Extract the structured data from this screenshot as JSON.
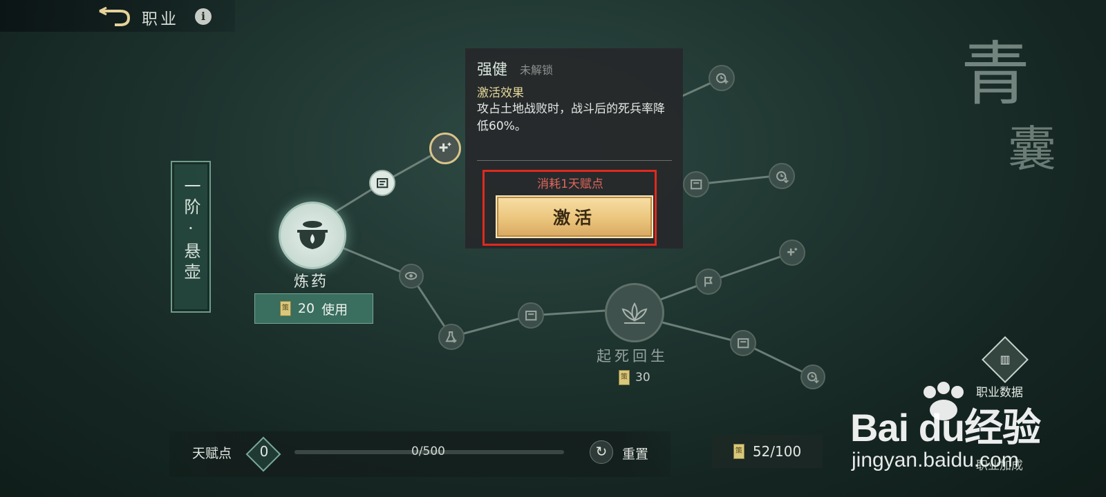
{
  "header": {
    "title": "职业",
    "info_icon": "i"
  },
  "tier": {
    "label": "一阶·悬壶"
  },
  "main_talent": {
    "name": "炼药",
    "cost": "20",
    "action": "使用"
  },
  "ultimate_talent": {
    "name": "起死回生",
    "cost": "30"
  },
  "tooltip": {
    "name": "强健",
    "status": "未解锁",
    "effect_heading": "激活效果",
    "effect_text": "攻占土地战败时，战斗后的死兵率降低60%。",
    "cost_text": "消耗1天赋点",
    "activate_label": "激活"
  },
  "calligraphy": {
    "char1": "青",
    "char2": "囊"
  },
  "talent_points": {
    "label": "天赋点",
    "value": "0",
    "progress_text": "0/500",
    "progress": 0.0,
    "reset_label": "重置",
    "reset_icon": "↻"
  },
  "coins": {
    "text": "52/100",
    "icon_char": "策"
  },
  "side": {
    "career_data_label": "职业数据",
    "career_detail_label": "职业加成"
  },
  "watermark": {
    "brand": "Bai du经验",
    "sub": "jingyan.baidu.com"
  },
  "colors": {
    "accent_green": "#3a6e5e",
    "gold": "#ebc57c",
    "highlight_red": "#e02a1e",
    "warning_red": "#e0665c"
  },
  "nodes": [
    {
      "id": "n-book1",
      "icon": "book-icon"
    },
    {
      "id": "n-plus1",
      "icon": "plus-sparkle-icon"
    },
    {
      "id": "n-eye",
      "icon": "eye-icon"
    },
    {
      "id": "n-flask",
      "icon": "flask-icon"
    },
    {
      "id": "n-book2",
      "icon": "book-icon"
    },
    {
      "id": "n-clockplus",
      "icon": "clock-plus-icon"
    },
    {
      "id": "n-book3",
      "icon": "book-icon"
    },
    {
      "id": "n-clockdown1",
      "icon": "clock-down-icon"
    },
    {
      "id": "n-flag",
      "icon": "flag-icon"
    },
    {
      "id": "n-plus2",
      "icon": "plus-sparkle-icon"
    },
    {
      "id": "n-book4",
      "icon": "book-icon"
    },
    {
      "id": "n-clockdown2",
      "icon": "clock-down-icon"
    }
  ]
}
